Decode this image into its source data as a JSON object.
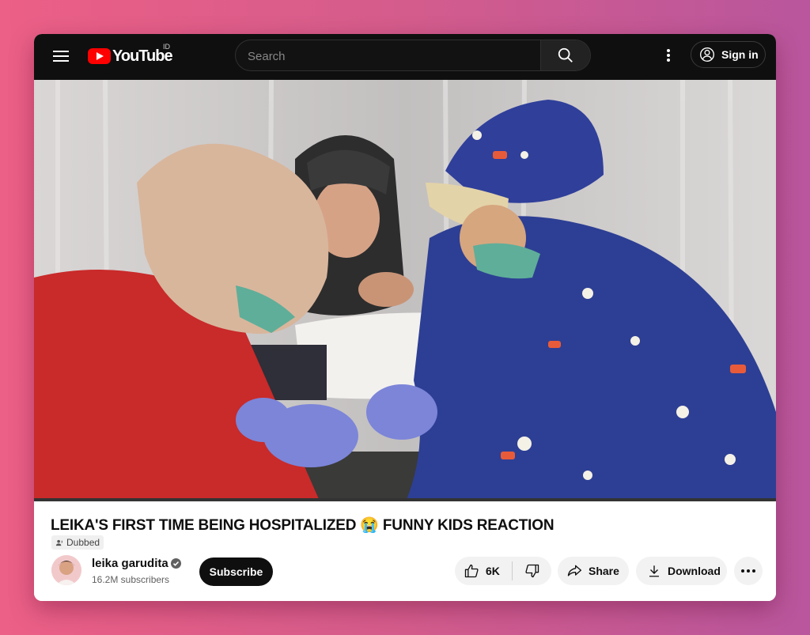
{
  "header": {
    "logo_text": "YouTube",
    "region": "ID",
    "search_placeholder": "Search",
    "sign_in_label": "Sign in"
  },
  "video": {
    "title": "LEIKA'S FIRST TIME BEING HOSPITALIZED 😭 FUNNY KIDS REACTION",
    "badge": "Dubbed"
  },
  "channel": {
    "name": "leika garudita",
    "subscribers": "16.2M subscribers",
    "subscribe_label": "Subscribe"
  },
  "actions": {
    "like_count": "6K",
    "share_label": "Share",
    "download_label": "Download"
  },
  "colors": {
    "brand_red": "#ff0000",
    "topbar": "#0f0f0f"
  }
}
